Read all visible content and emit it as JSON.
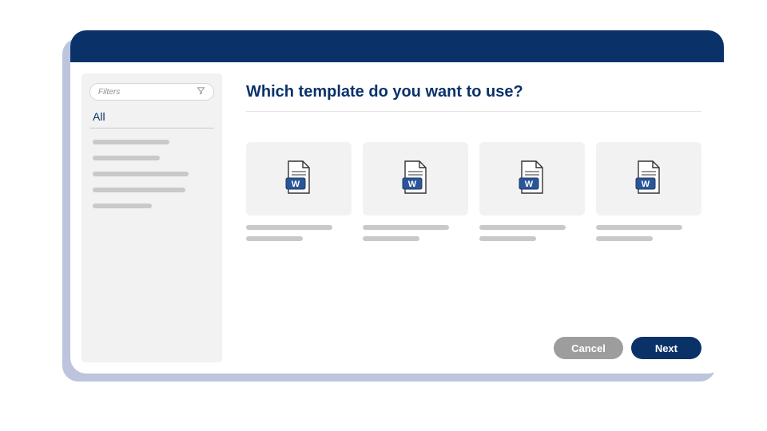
{
  "sidebar": {
    "filters_label": "Filters",
    "selected_category": "All",
    "placeholder_count": 5
  },
  "main": {
    "heading": "Which template do you want to use?",
    "template_count": 4
  },
  "footer": {
    "cancel_label": "Cancel",
    "next_label": "Next"
  },
  "colors": {
    "brand": "#0a3269",
    "shadow": "#bcc4de",
    "panel_bg": "#f2f2f2",
    "placeholder": "#c9c9c9",
    "word_blue": "#2a5699"
  }
}
